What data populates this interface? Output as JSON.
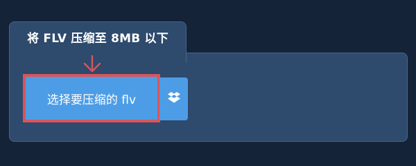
{
  "tab": {
    "title": "将 FLV 压缩至 8MB 以下"
  },
  "upload": {
    "button_label": "选择要压缩的 flv",
    "dropbox_icon": "dropbox-icon",
    "arrow_icon": "arrow-down-icon"
  },
  "colors": {
    "background": "#142337",
    "panel": "#2e4a6d",
    "button": "#4d9de6",
    "highlight": "#d9545a"
  }
}
